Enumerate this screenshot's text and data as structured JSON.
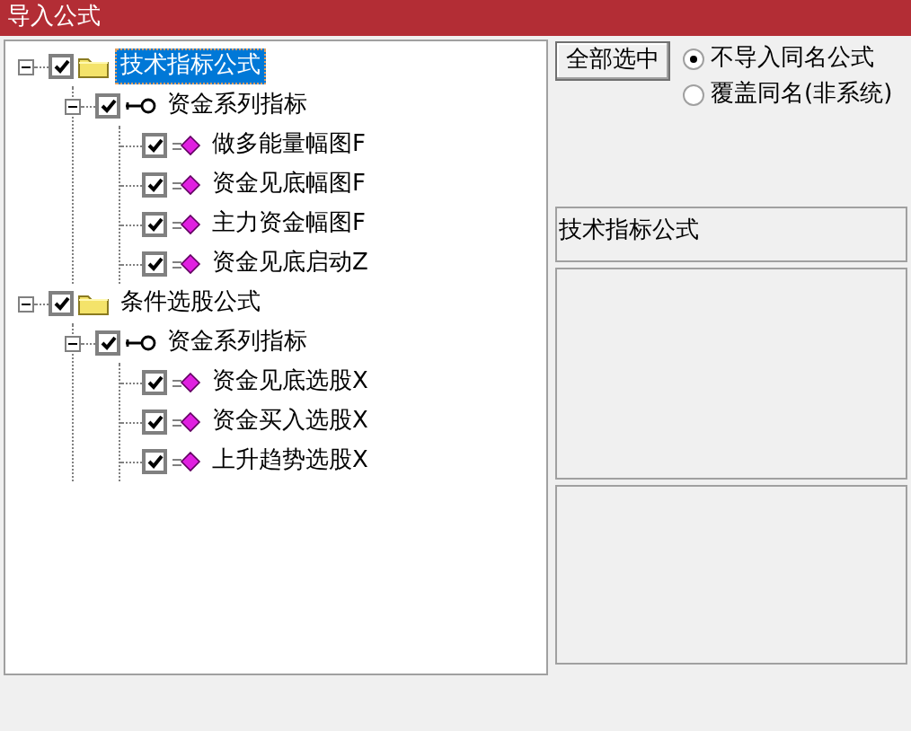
{
  "window": {
    "title": "导入公式"
  },
  "tree": [
    {
      "label": "技术指标公式",
      "kind": "folder",
      "checked": true,
      "expanded": true,
      "selected": true,
      "children": [
        {
          "label": "资金系列指标",
          "kind": "group",
          "checked": true,
          "expanded": true,
          "selected": false,
          "children": [
            {
              "label": "做多能量幅图F",
              "kind": "formula",
              "checked": true,
              "selected": false
            },
            {
              "label": "资金见底幅图F",
              "kind": "formula",
              "checked": true,
              "selected": false
            },
            {
              "label": "主力资金幅图F",
              "kind": "formula",
              "checked": true,
              "selected": false
            },
            {
              "label": "资金见底启动Z",
              "kind": "formula",
              "checked": true,
              "selected": false
            }
          ]
        }
      ]
    },
    {
      "label": "条件选股公式",
      "kind": "folder",
      "checked": true,
      "expanded": true,
      "selected": false,
      "children": [
        {
          "label": "资金系列指标",
          "kind": "group",
          "checked": true,
          "expanded": true,
          "selected": false,
          "children": [
            {
              "label": "资金见底选股X",
              "kind": "formula",
              "checked": true,
              "selected": false
            },
            {
              "label": "资金买入选股X",
              "kind": "formula",
              "checked": true,
              "selected": false
            },
            {
              "label": "上升趋势选股X",
              "kind": "formula",
              "checked": true,
              "selected": false
            }
          ]
        }
      ]
    }
  ],
  "select_all_button": "全部选中",
  "options": [
    {
      "label": "不导入同名公式",
      "selected": true
    },
    {
      "label": "覆盖同名(非系统)",
      "selected": false
    }
  ],
  "description": "技术指标公式"
}
